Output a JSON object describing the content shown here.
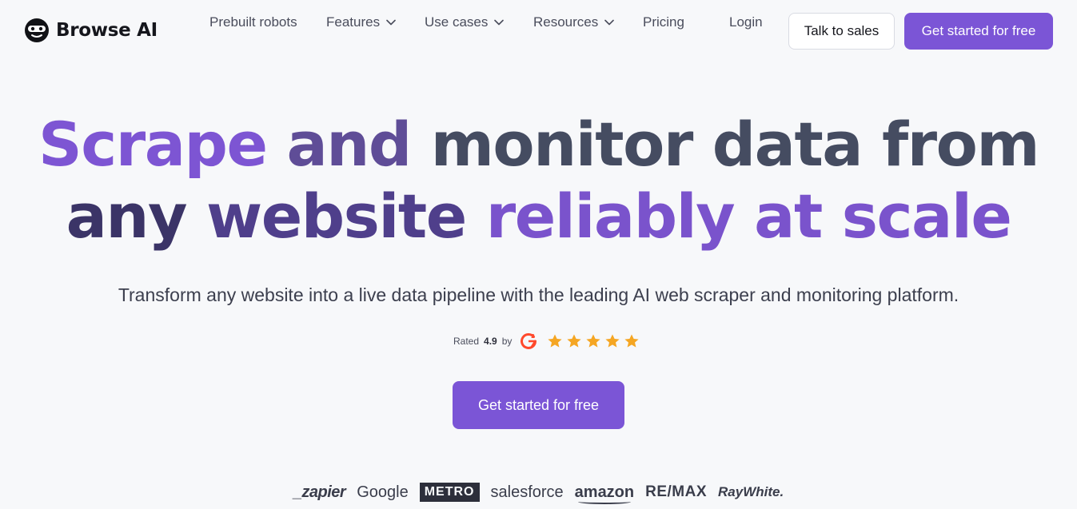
{
  "brand": {
    "name": "Browse AI",
    "icon": "robot-mask-icon"
  },
  "nav": {
    "items": [
      {
        "label": "Prebuilt robots",
        "has_dropdown": false
      },
      {
        "label": "Features",
        "has_dropdown": true
      },
      {
        "label": "Use cases",
        "has_dropdown": true
      },
      {
        "label": "Resources",
        "has_dropdown": true
      },
      {
        "label": "Pricing",
        "has_dropdown": false
      }
    ],
    "login_label": "Login",
    "sales_label": "Talk to sales",
    "cta_label": "Get started for free"
  },
  "hero": {
    "title_line1": [
      "Scrape",
      "and",
      "monitor",
      "data",
      "from"
    ],
    "title_line2": [
      "any",
      "website",
      "reliably",
      "at",
      "scale"
    ],
    "subtitle": "Transform any website into a live data pipeline with the leading AI web scraper and monitoring platform.",
    "rating": {
      "prefix": "Rated",
      "score": "4.9",
      "suffix": "by",
      "source_icon": "g2-logo-icon",
      "stars": 5
    },
    "cta_label": "Get started for free"
  },
  "logos": [
    "_zapier",
    "Google",
    "METRO",
    "salesforce",
    "amazon",
    "RE/MAX",
    "RayWhite."
  ],
  "colors": {
    "accent": "#7b55d6",
    "background": "#f7f8fa",
    "star": "#f5a623",
    "g2_red": "#ff492c"
  }
}
